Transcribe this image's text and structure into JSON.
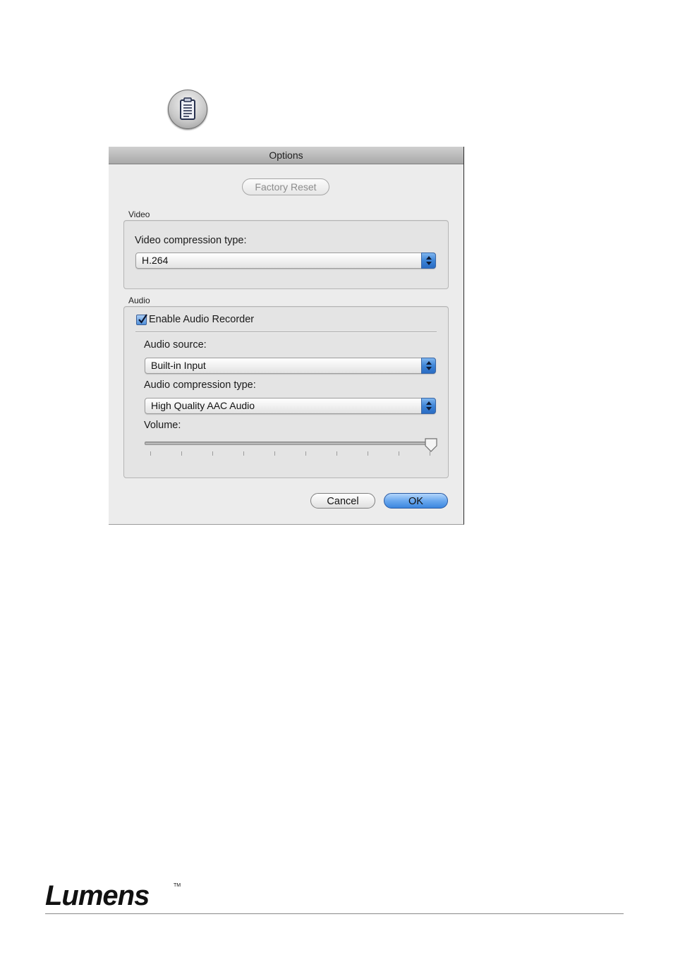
{
  "dialog": {
    "title": "Options",
    "factory_reset_label": "Factory Reset",
    "video_group_label": "Video",
    "video_compression_label": "Video compression type:",
    "video_compression_value": "H.264",
    "audio_group_label": "Audio",
    "enable_audio_label": "Enable Audio Recorder",
    "enable_audio_checked": true,
    "audio_source_label": "Audio source:",
    "audio_source_value": "Built-in Input",
    "audio_compression_label": "Audio compression type:",
    "audio_compression_value": "High Quality AAC Audio",
    "volume_label": "Volume:",
    "volume_level": 1.0,
    "volume_tick_count": 10,
    "cancel_label": "Cancel",
    "ok_label": "OK"
  },
  "icons": {
    "options_button": "clipboard-checklist-icon",
    "popup_arrows": "up-down-arrows-icon",
    "checkbox_mark": "checkmark-icon"
  },
  "colors": {
    "accent_blue": "#3d84d6",
    "ok_button": "#6aa8ee",
    "dialog_bg": "#ececec"
  },
  "footer": {
    "brand": "Lumens",
    "trademark": "TM"
  }
}
